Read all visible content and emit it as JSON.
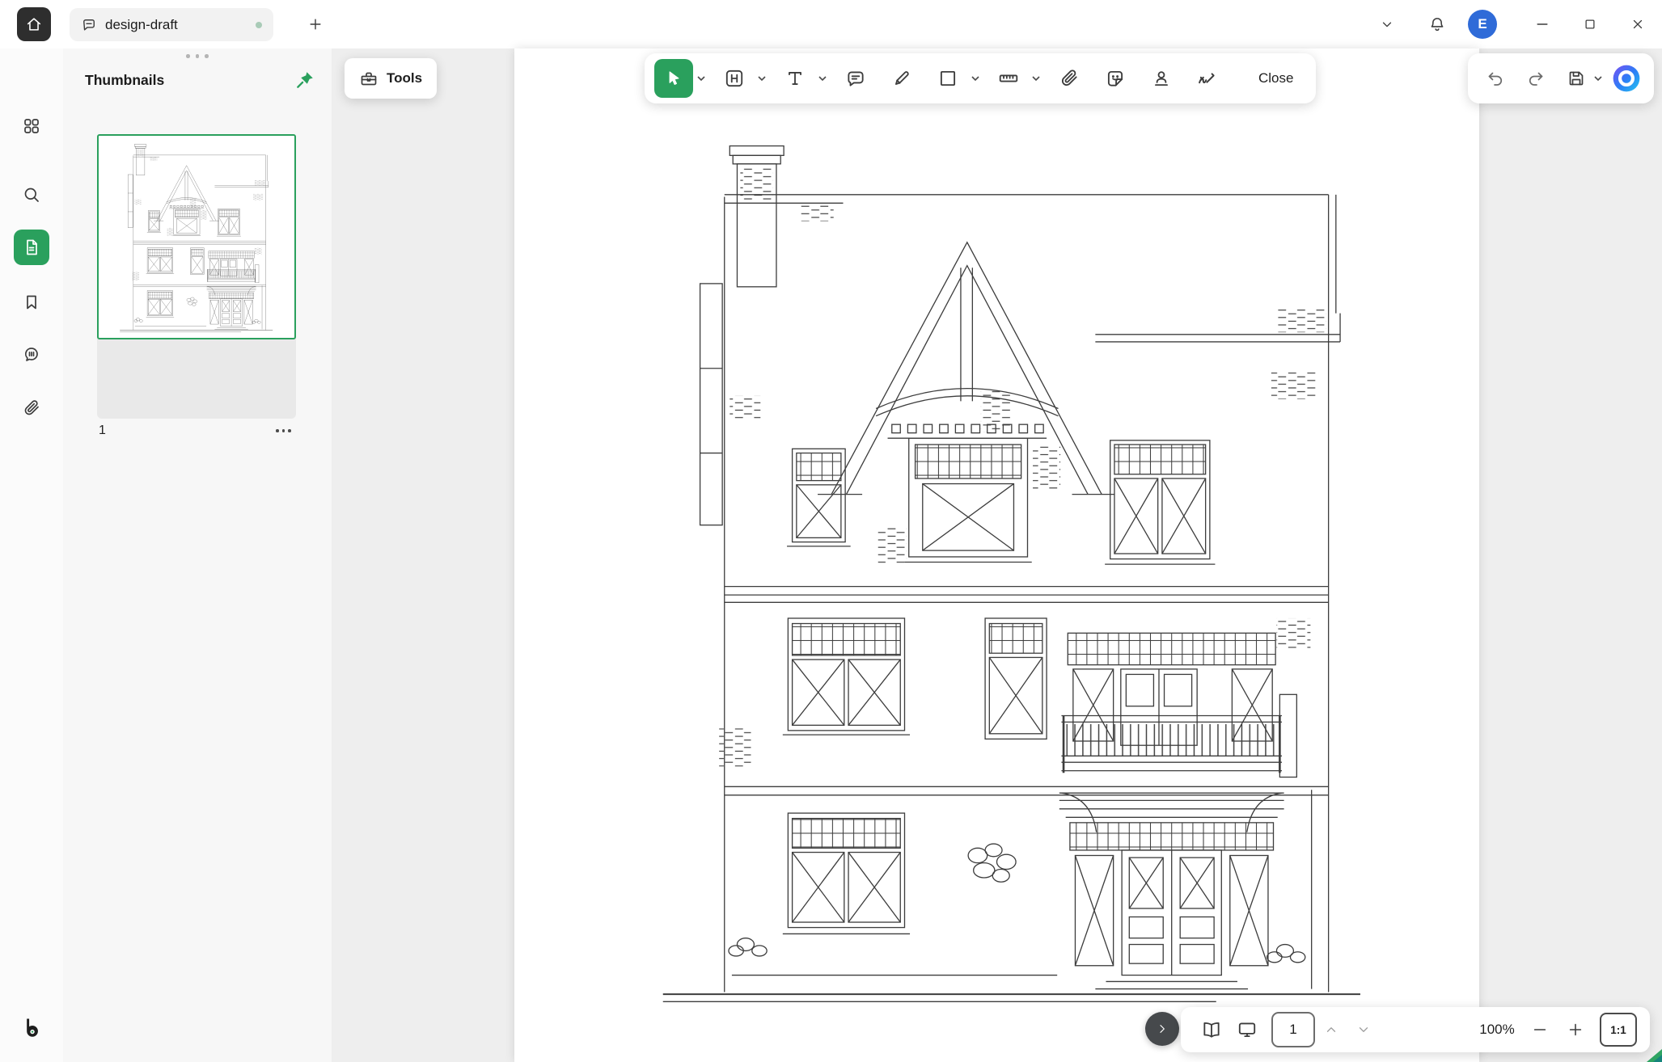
{
  "titlebar": {
    "tab_label": "design-draft",
    "avatar_initial": "E",
    "icons": [
      "home",
      "annotation-bubble",
      "plus",
      "chevron-down",
      "bell",
      "minimize",
      "maximize",
      "close"
    ]
  },
  "sidebar": {
    "items": [
      {
        "icon": "apps-grid",
        "active": false
      },
      {
        "icon": "search",
        "active": false
      },
      {
        "icon": "documents",
        "active": true
      },
      {
        "icon": "bookmarks",
        "active": false
      },
      {
        "icon": "comments",
        "active": false
      },
      {
        "icon": "attachments",
        "active": false
      }
    ],
    "logo_icon": "drawboard-logo"
  },
  "thumbnails_panel": {
    "title": "Thumbnails",
    "pin_icon": "pushpin",
    "pages": [
      {
        "label": "1",
        "selected": true,
        "content": "house front elevation line drawing"
      }
    ]
  },
  "tools_button": {
    "label": "Tools",
    "icon": "toolbox"
  },
  "main_toolbar": {
    "tools": [
      {
        "icon": "select-cursor",
        "active": true,
        "has_dropdown": true
      },
      {
        "icon": "frame-h",
        "has_dropdown": true
      },
      {
        "icon": "text",
        "has_dropdown": true
      },
      {
        "icon": "comment",
        "has_dropdown": false
      },
      {
        "icon": "pen",
        "has_dropdown": false
      },
      {
        "icon": "shape-square",
        "has_dropdown": true
      },
      {
        "icon": "ruler",
        "has_dropdown": true
      },
      {
        "icon": "paperclip",
        "has_dropdown": false
      },
      {
        "icon": "sticker",
        "has_dropdown": false
      },
      {
        "icon": "stamp",
        "has_dropdown": false
      },
      {
        "icon": "signature",
        "has_dropdown": false
      }
    ],
    "close_label": "Close"
  },
  "quick_actions": {
    "icons": [
      "undo",
      "redo",
      "save",
      "copilot"
    ]
  },
  "statusbar": {
    "expand_icon": "chevron-right",
    "reading_icon": "book-open",
    "present_icon": "screen",
    "page_input_value": "1",
    "page_nav_icons": [
      "chevron-up",
      "chevron-down"
    ],
    "zoom_label": "100%",
    "zoom_icons": [
      "minus",
      "plus"
    ],
    "fit_label": "1:1"
  },
  "canvas": {
    "page_content": "architectural front elevation drawing of a three-storey gabled house"
  },
  "colors": {
    "accent_green": "#2aa05d",
    "avatar_blue": "#2f6bd8",
    "canvas_gray": "#eeeeee",
    "dark_button": "#46494c"
  }
}
